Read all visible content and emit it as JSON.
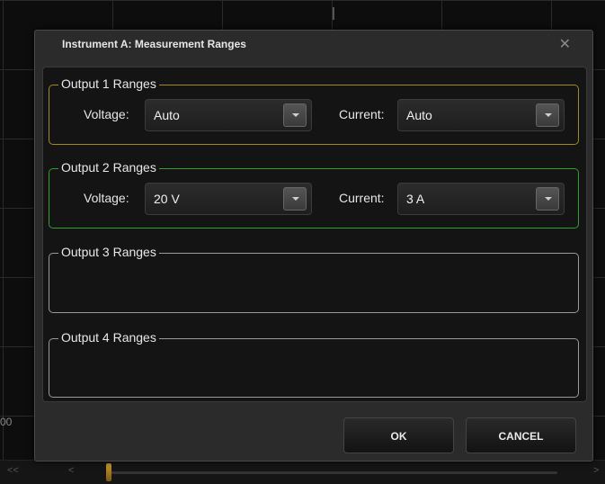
{
  "background": {
    "axis_label": "00"
  },
  "dialog": {
    "title": "Instrument A: Measurement Ranges",
    "close": "✕",
    "groups": [
      {
        "label": "Output 1 Ranges",
        "border_color": "#a08a1a",
        "voltage_label": "Voltage:",
        "voltage_value": "Auto",
        "current_label": "Current:",
        "current_value": "Auto"
      },
      {
        "label": "Output 2 Ranges",
        "border_color": "#2ea02e",
        "voltage_label": "Voltage:",
        "voltage_value": "20 V",
        "current_label": "Current:",
        "current_value": "3 A"
      },
      {
        "label": "Output 3 Ranges",
        "border_color": "#9a9a9a"
      },
      {
        "label": "Output 4 Ranges",
        "border_color": "#9a9a9a"
      }
    ],
    "ok_label": "OK",
    "cancel_label": "CANCEL"
  },
  "bottom_bar": {
    "left_label": "<<",
    "prev_label": "<",
    "next_label": ">"
  }
}
